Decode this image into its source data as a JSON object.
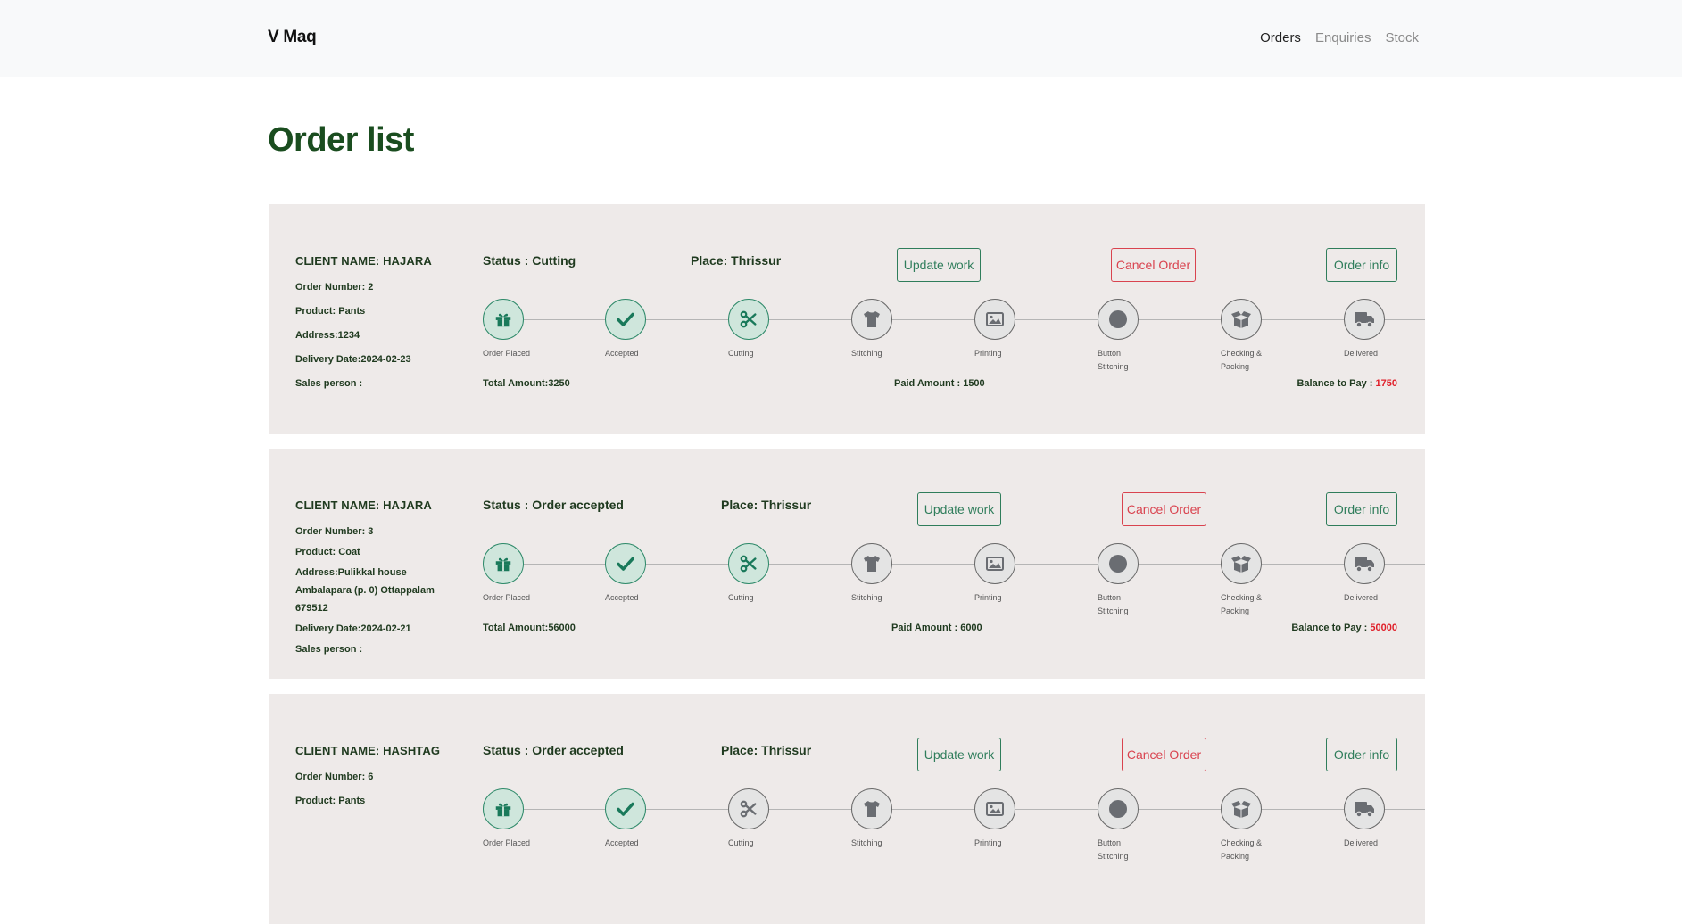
{
  "brand": "V Maq",
  "nav": {
    "orders": "Orders",
    "enquiries": "Enquiries",
    "stock": "Stock"
  },
  "page_title": "Order list",
  "labels": {
    "update": "Update work",
    "cancel": "Cancel Order",
    "info": "Order info"
  },
  "steps": [
    "Order Placed",
    "Accepted",
    "Cutting",
    "Stitching",
    "Printing",
    "Button Stitching",
    "Checking & Packing",
    "Delivered"
  ],
  "orders": [
    {
      "client": "CLIENT NAME: HAJARA",
      "order_number": "Order Number: 2",
      "product": "Product: Pants",
      "address": "Address:1234",
      "delivery": "Delivery Date:2024-02-23",
      "sales": "Sales person :",
      "status": "Status : Cutting",
      "place": "Place: Thrissur",
      "total": "Total Amount:3250",
      "paid": "Paid Amount : 1500",
      "balance_label": "Balance to Pay :",
      "balance": "1750",
      "progress": 3
    },
    {
      "client": "CLIENT NAME: HAJARA",
      "order_number": "Order Number: 3",
      "product": "Product: Coat",
      "address": "Address:Pulikkal house Ambalapara (p. 0) Ottappalam 679512",
      "delivery": "Delivery Date:2024-02-21",
      "sales": "Sales person :",
      "status": "Status : Order accepted",
      "place": "Place: Thrissur",
      "total": "Total Amount:56000",
      "paid": "Paid Amount : 6000",
      "balance_label": "Balance to Pay :",
      "balance": "50000",
      "progress": 3
    },
    {
      "client": "CLIENT NAME: HASHTAG",
      "order_number": "Order Number: 6",
      "product": "Product: Pants",
      "status": "Status : Order accepted",
      "place": "Place: Thrissur",
      "progress": 2
    }
  ],
  "colors": {
    "accent_green": "#2f7d5b",
    "danger_red": "#d9434f",
    "title_green": "#1a4d1f",
    "card_bg": "#eeeae9"
  }
}
